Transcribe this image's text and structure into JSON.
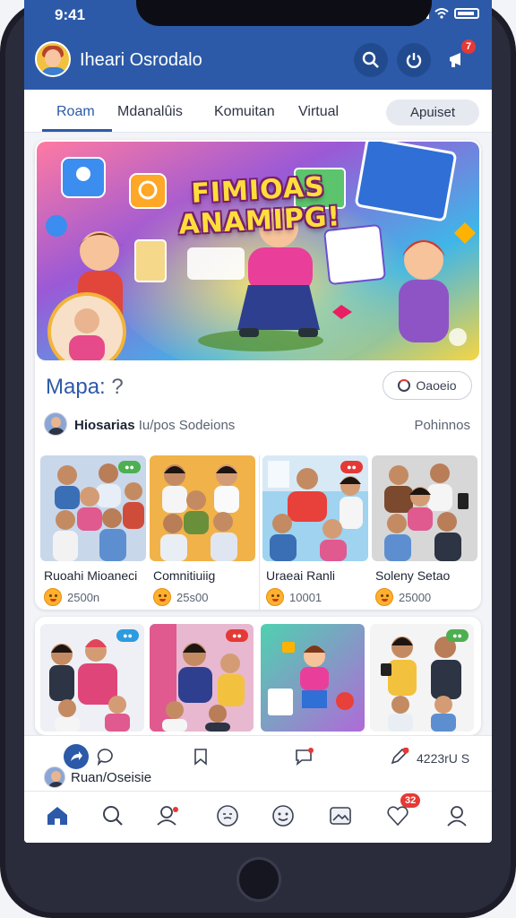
{
  "status": {
    "time": "9:41"
  },
  "header": {
    "title": "Iheari Osrodalo",
    "notification_count": "7"
  },
  "tabs": [
    {
      "label": "Roam",
      "active": true
    },
    {
      "label": "Mdanalûis"
    },
    {
      "label": "Komuitan"
    },
    {
      "label": "Virtual"
    }
  ],
  "tab_pill": "Apuiset",
  "banner": {
    "title": "FIMIOAS ANAMIPG!"
  },
  "maps": {
    "label": "Mapa:",
    "question": "?",
    "button_label": "Oaoeio"
  },
  "session": {
    "name": "Hiosarias",
    "text": "Iu/pos Sodeions",
    "right": "Pohinnos"
  },
  "groups": [
    {
      "name": "Ruoahi Mioaneci",
      "count": "2500n",
      "chip_color": "#4caf50"
    },
    {
      "name": "Comnitiuiig",
      "count": "25s00",
      "chip_color": ""
    },
    {
      "name": "Uraeai Ranli",
      "count": "10001",
      "chip_color": "#e53935"
    },
    {
      "name": "Soleny Setao",
      "count": "25000",
      "chip_color": ""
    }
  ],
  "row2_chips": [
    "#2c9be0",
    "#e53935",
    "",
    "#4caf50"
  ],
  "composer": {
    "username": "Ruan/Oseisie",
    "count_label": "4223rU S"
  },
  "nav": {
    "items": [
      "home-icon",
      "search-icon",
      "profile-add-icon",
      "chat-face-icon",
      "emoji-icon",
      "photo-icon",
      "heart-icon",
      "user-icon"
    ],
    "badge": "32"
  },
  "colors": {
    "primary": "#2c5aa8",
    "badge": "#e53935",
    "banner_gradient": [
      "#ff6f91",
      "#9b59d6",
      "#3fb6e8",
      "#f6d543"
    ]
  }
}
